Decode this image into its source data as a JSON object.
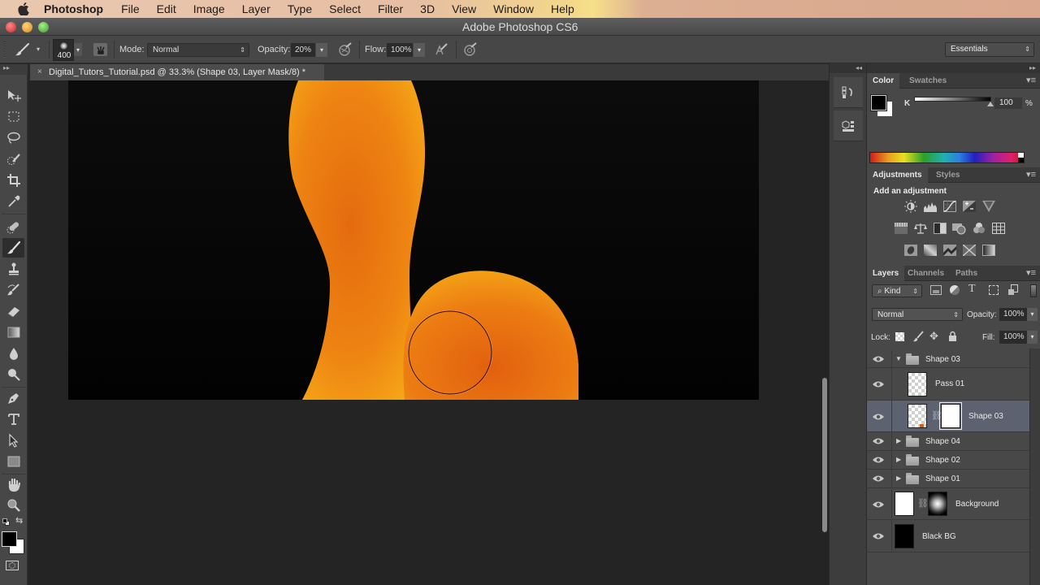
{
  "menubar": {
    "app_name": "Photoshop",
    "items": [
      "File",
      "Edit",
      "Image",
      "Layer",
      "Type",
      "Select",
      "Filter",
      "3D",
      "View",
      "Window",
      "Help"
    ]
  },
  "window": {
    "title": "Adobe Photoshop CS6"
  },
  "options_bar": {
    "brush_size": "400",
    "mode_label": "Mode:",
    "mode_value": "Normal",
    "opacity_label": "Opacity:",
    "opacity_value": "20%",
    "flow_label": "Flow:",
    "flow_value": "100%",
    "workspace": "Essentials"
  },
  "document": {
    "tab_title": "Digital_Tutors_Tutorial.psd @ 33.3% (Shape 03, Layer Mask/8) *",
    "close": "×"
  },
  "toolbar": {
    "tools": [
      "move-tool",
      "marquee-tool",
      "lasso-tool",
      "quick-selection-tool",
      "crop-tool",
      "eyedropper-tool",
      "healing-brush-tool",
      "brush-tool",
      "clone-stamp-tool",
      "history-brush-tool",
      "eraser-tool",
      "gradient-tool",
      "blur-tool",
      "dodge-tool",
      "pen-tool",
      "type-tool",
      "path-selection-tool",
      "rectangle-tool",
      "hand-tool",
      "zoom-tool"
    ],
    "active_tool": "brush-tool",
    "foreground_color": "#000000",
    "background_color": "#ffffff"
  },
  "color_panel": {
    "tabs": [
      "Color",
      "Swatches"
    ],
    "active_tab": "Color",
    "channel_label": "K",
    "channel_value": "100",
    "unit": "%"
  },
  "adjustments_panel": {
    "tabs": [
      "Adjustments",
      "Styles"
    ],
    "active_tab": "Adjustments",
    "heading": "Add an adjustment",
    "rows": [
      [
        "brightness-contrast",
        "levels",
        "curves",
        "exposure",
        "vibrance"
      ],
      [
        "hue-saturation",
        "color-balance",
        "black-white",
        "photo-filter",
        "channel-mixer",
        "color-lookup"
      ],
      [
        "invert",
        "posterize",
        "threshold",
        "selective-color",
        "gradient-map"
      ]
    ]
  },
  "layers_panel": {
    "tabs": [
      "Layers",
      "Channels",
      "Paths"
    ],
    "active_tab": "Layers",
    "filter_kind": "Kind",
    "blend_mode": "Normal",
    "opacity_label": "Opacity:",
    "opacity_value": "100%",
    "lock_label": "Lock:",
    "fill_label": "Fill:",
    "fill_value": "100%",
    "layers": [
      {
        "name": "Shape 03",
        "type": "group",
        "expanded": true,
        "visible": true,
        "selected": false
      },
      {
        "name": "Pass 01",
        "type": "layer",
        "visible": true,
        "selected": false
      },
      {
        "name": "Shape 03",
        "type": "layer-with-mask",
        "visible": true,
        "selected": true
      },
      {
        "name": "Shape 04",
        "type": "group",
        "expanded": false,
        "visible": true,
        "selected": false
      },
      {
        "name": "Shape 02",
        "type": "group",
        "expanded": false,
        "visible": true,
        "selected": false
      },
      {
        "name": "Shape 01",
        "type": "group",
        "expanded": false,
        "visible": true,
        "selected": false
      },
      {
        "name": "Background",
        "type": "layer-with-mask",
        "visible": true,
        "selected": false
      },
      {
        "name": "Black BG",
        "type": "layer",
        "visible": true,
        "selected": false
      }
    ]
  },
  "colors": {
    "shape_orange_light": "#f5a515",
    "shape_orange_dark": "#e4680e",
    "canvas_bg": "#050505",
    "selected_layer": "#5d6270"
  }
}
